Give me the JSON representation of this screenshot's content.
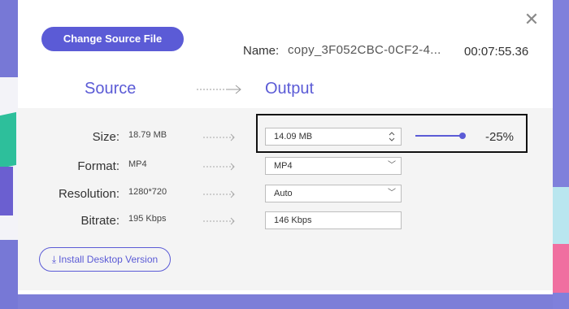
{
  "header": {
    "change_source_label": "Change Source File",
    "name_label": "Name:",
    "file_name": "copy_3F052CBC-0CF2-4...",
    "duration": "00:07:55.36",
    "close_icon": "close-icon"
  },
  "columns": {
    "source": "Source",
    "output": "Output"
  },
  "rows": {
    "size": {
      "label": "Size:",
      "source": "18.79  MB",
      "output": "14.09  MB"
    },
    "format": {
      "label": "Format:",
      "source": "MP4",
      "output": "MP4"
    },
    "resolution": {
      "label": "Resolution:",
      "source": "1280*720",
      "output": "Auto"
    },
    "bitrate": {
      "label": "Bitrate:",
      "source": "195  Kbps",
      "output": "146 Kbps"
    }
  },
  "compression": {
    "percent_label": "-25%",
    "slider_level": 0.9
  },
  "install_label": "Install Desktop Version",
  "colors": {
    "accent": "#5b5bd6"
  }
}
